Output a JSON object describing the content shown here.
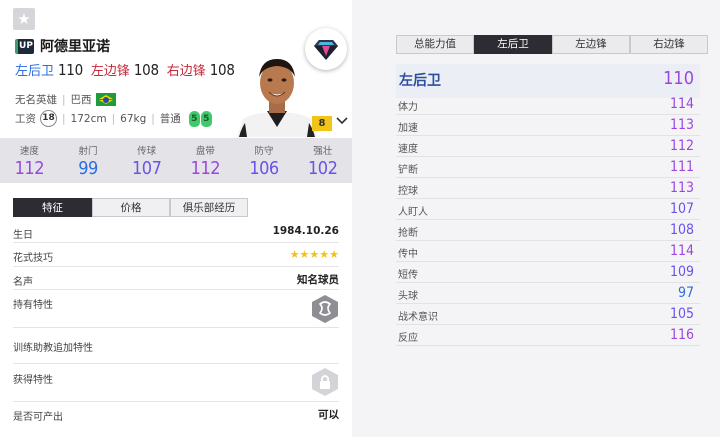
{
  "player": {
    "badge": "UP",
    "name": "阿德里亚诺",
    "positions": [
      {
        "name": "左后卫",
        "value": "110",
        "color": "#2e6ee0"
      },
      {
        "name": "左边锋",
        "value": "108",
        "color": "#c8283a"
      },
      {
        "name": "右边锋",
        "value": "108",
        "color": "#c8283a"
      }
    ],
    "team": "无名英雄",
    "nationality": "巴西",
    "wage_label": "工资",
    "wage": "18",
    "height": "172cm",
    "weight": "67kg",
    "body_type": "普通",
    "weak_foot_left": "5",
    "weak_foot_right": "5",
    "level": "8"
  },
  "stats": [
    {
      "label": "速度",
      "value": "112",
      "color": "#9b46e0"
    },
    {
      "label": "射门",
      "value": "99",
      "color": "#2e6ee0"
    },
    {
      "label": "传球",
      "value": "107",
      "color": "#6b52e8"
    },
    {
      "label": "盘带",
      "value": "112",
      "color": "#9b46e0"
    },
    {
      "label": "防守",
      "value": "106",
      "color": "#6b52e8"
    },
    {
      "label": "强壮",
      "value": "102",
      "color": "#6b52e8"
    }
  ],
  "left_tabs": [
    "特征",
    "价格",
    "俱乐部经历"
  ],
  "details": {
    "birthday_label": "生日",
    "birthday": "1984.10.26",
    "skill_label": "花式技巧",
    "skill_stars": "★★★★★",
    "reputation_label": "名声",
    "reputation": "知名球员",
    "traits_label": "持有特性",
    "training_label": "训练助教追加特性",
    "acquired_label": "获得特性",
    "tradable_label": "是否可产出",
    "tradable": "可以"
  },
  "right_tabs": [
    "总能力值",
    "左后卫",
    "左边锋",
    "右边锋"
  ],
  "main_position": {
    "label": "左后卫",
    "value": "110"
  },
  "attributes": [
    {
      "label": "体力",
      "value": "114",
      "color": "#9b46e0"
    },
    {
      "label": "加速",
      "value": "113",
      "color": "#9b46e0"
    },
    {
      "label": "速度",
      "value": "112",
      "color": "#9b46e0"
    },
    {
      "label": "铲断",
      "value": "111",
      "color": "#9b46e0"
    },
    {
      "label": "控球",
      "value": "113",
      "color": "#9b46e0"
    },
    {
      "label": "人盯人",
      "value": "107",
      "color": "#6b52e8"
    },
    {
      "label": "抢断",
      "value": "108",
      "color": "#6b52e8"
    },
    {
      "label": "传中",
      "value": "114",
      "color": "#9b46e0"
    },
    {
      "label": "短传",
      "value": "109",
      "color": "#6b52e8"
    },
    {
      "label": "头球",
      "value": "97",
      "color": "#2e6ee0"
    },
    {
      "label": "战术意识",
      "value": "105",
      "color": "#6b52e8"
    },
    {
      "label": "反应",
      "value": "116",
      "color": "#9b46e0"
    }
  ]
}
